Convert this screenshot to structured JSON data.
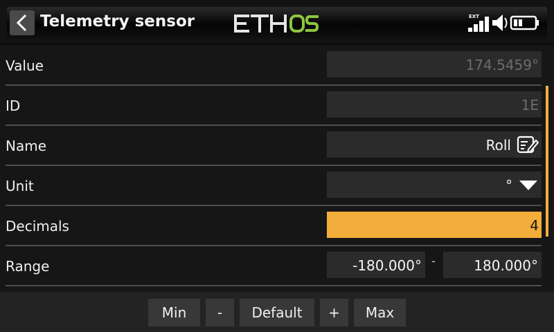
{
  "header": {
    "title": "Telemetry sensor",
    "logo_text": "ETHOS",
    "ext_label": "EXT",
    "back_icon": "chevron-left-icon",
    "status_icons": [
      "signal-icon",
      "speaker-icon",
      "battery-icon"
    ]
  },
  "rows": {
    "value": {
      "label": "Value",
      "value": "174.5459°"
    },
    "id": {
      "label": "ID",
      "value": "1E"
    },
    "name": {
      "label": "Name",
      "value": "Roll"
    },
    "unit": {
      "label": "Unit",
      "value": "°"
    },
    "decimals": {
      "label": "Decimals",
      "value": "4"
    },
    "range": {
      "label": "Range",
      "min": "-180.000°",
      "separator": "-",
      "max": "180.000°"
    }
  },
  "bottom_buttons": {
    "min": "Min",
    "minus": "-",
    "default": "Default",
    "plus": "+",
    "max": "Max"
  },
  "colors": {
    "accent": "#f3ad3a",
    "logo_green": "#8dc63f",
    "field_bg": "#2b2b2b",
    "background": "#161616"
  }
}
